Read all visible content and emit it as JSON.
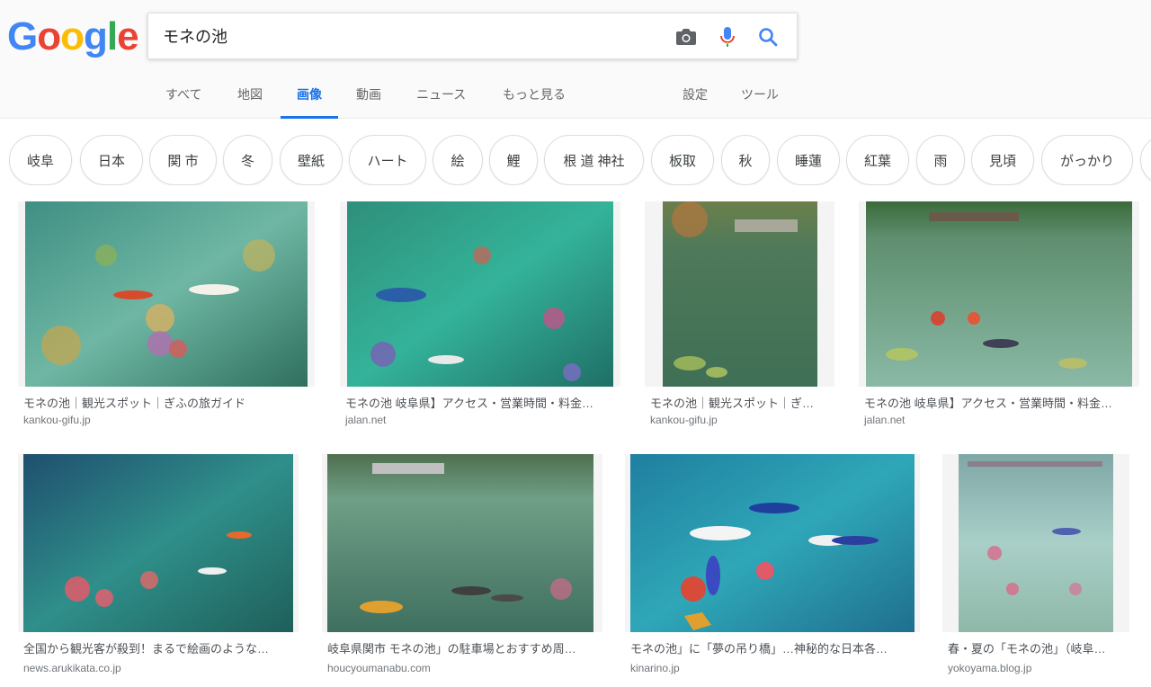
{
  "search": {
    "query": "モネの池",
    "logo_letters": [
      {
        "ch": "G",
        "color": "#4285F4"
      },
      {
        "ch": "o",
        "color": "#EA4335"
      },
      {
        "ch": "o",
        "color": "#FBBC05"
      },
      {
        "ch": "g",
        "color": "#4285F4"
      },
      {
        "ch": "l",
        "color": "#34A853"
      },
      {
        "ch": "e",
        "color": "#EA4335"
      }
    ],
    "icons": {
      "camera": "camera-icon",
      "mic": "mic-icon",
      "search": "search-icon"
    }
  },
  "tabs": {
    "all": "すべて",
    "maps": "地図",
    "images": "画像",
    "videos": "動画",
    "news": "ニュース",
    "more": "もっと見る",
    "settings": "設定",
    "tools": "ツール"
  },
  "chips": [
    "岐阜",
    "日本",
    "関 市",
    "冬",
    "壁紙",
    "ハート",
    "絵",
    "鯉",
    "根 道 神社",
    "板取",
    "秋",
    "睡蓮",
    "紅葉",
    "雨",
    "見頃",
    "がっかり"
  ],
  "results": [
    {
      "title": "モネの池｜観光スポット｜ぎふの旅ガイド",
      "source": "kankou-gifu.jp"
    },
    {
      "title": "モネの池 岐阜県】アクセス・営業時間・料金…",
      "source": "jalan.net"
    },
    {
      "title": "モネの池｜観光スポット｜ぎ…",
      "source": "kankou-gifu.jp"
    },
    {
      "title": "モネの池 岐阜県】アクセス・営業時間・料金…",
      "source": "jalan.net"
    },
    {
      "title": "全国から観光客が殺到！まるで絵画のような…",
      "source": "news.arukikata.co.jp"
    },
    {
      "title": "岐阜県関市 モネの池」の駐車場とおすすめ周…",
      "source": "houcyoumanabu.com"
    },
    {
      "title": "モネの池」に「夢の吊り橋」…神秘的な日本各…",
      "source": "kinarino.jp"
    },
    {
      "title": "春・夏の「モネの池」（岐阜…",
      "source": "yokoyama.blog.jp"
    }
  ],
  "colors": {
    "accent": "#1a73e8"
  }
}
